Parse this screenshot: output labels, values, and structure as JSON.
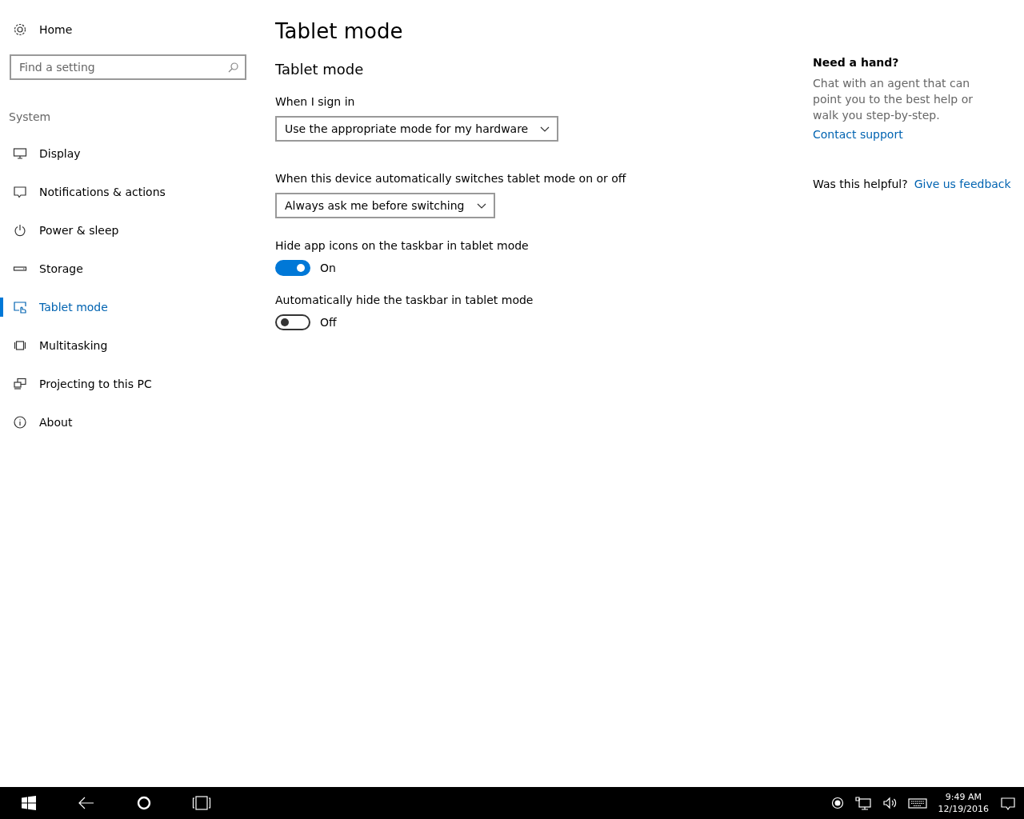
{
  "sidebar": {
    "home": "Home",
    "search": {
      "placeholder": "Find a setting"
    },
    "section": "System",
    "items": [
      {
        "label": "Display",
        "selected": false
      },
      {
        "label": "Notifications & actions",
        "selected": false
      },
      {
        "label": "Power & sleep",
        "selected": false
      },
      {
        "label": "Storage",
        "selected": false
      },
      {
        "label": "Tablet mode",
        "selected": true
      },
      {
        "label": "Multitasking",
        "selected": false
      },
      {
        "label": "Projecting to this PC",
        "selected": false
      },
      {
        "label": "About",
        "selected": false
      }
    ]
  },
  "page": {
    "title": "Tablet mode",
    "subtitle": "Tablet mode",
    "settings": [
      {
        "kind": "dropdown",
        "label": "When I sign in",
        "value": "Use the appropriate mode for my hardware"
      },
      {
        "kind": "dropdown",
        "label": "When this device automatically switches tablet mode on or off",
        "value": "Always ask me before switching"
      },
      {
        "kind": "toggle",
        "label": "Hide app icons on the taskbar in tablet mode",
        "on": true,
        "state": "On"
      },
      {
        "kind": "toggle",
        "label": "Automatically hide the taskbar in tablet mode",
        "on": false,
        "state": "Off"
      }
    ]
  },
  "help": {
    "title": "Need a hand?",
    "text": "Chat with an agent that can point you to the best help or walk you step-by-step.",
    "link": "Contact support",
    "question": "Was this helpful?",
    "feedback": "Give us feedback"
  },
  "taskbar": {
    "time": "9:49 AM",
    "date": "12/19/2016"
  }
}
